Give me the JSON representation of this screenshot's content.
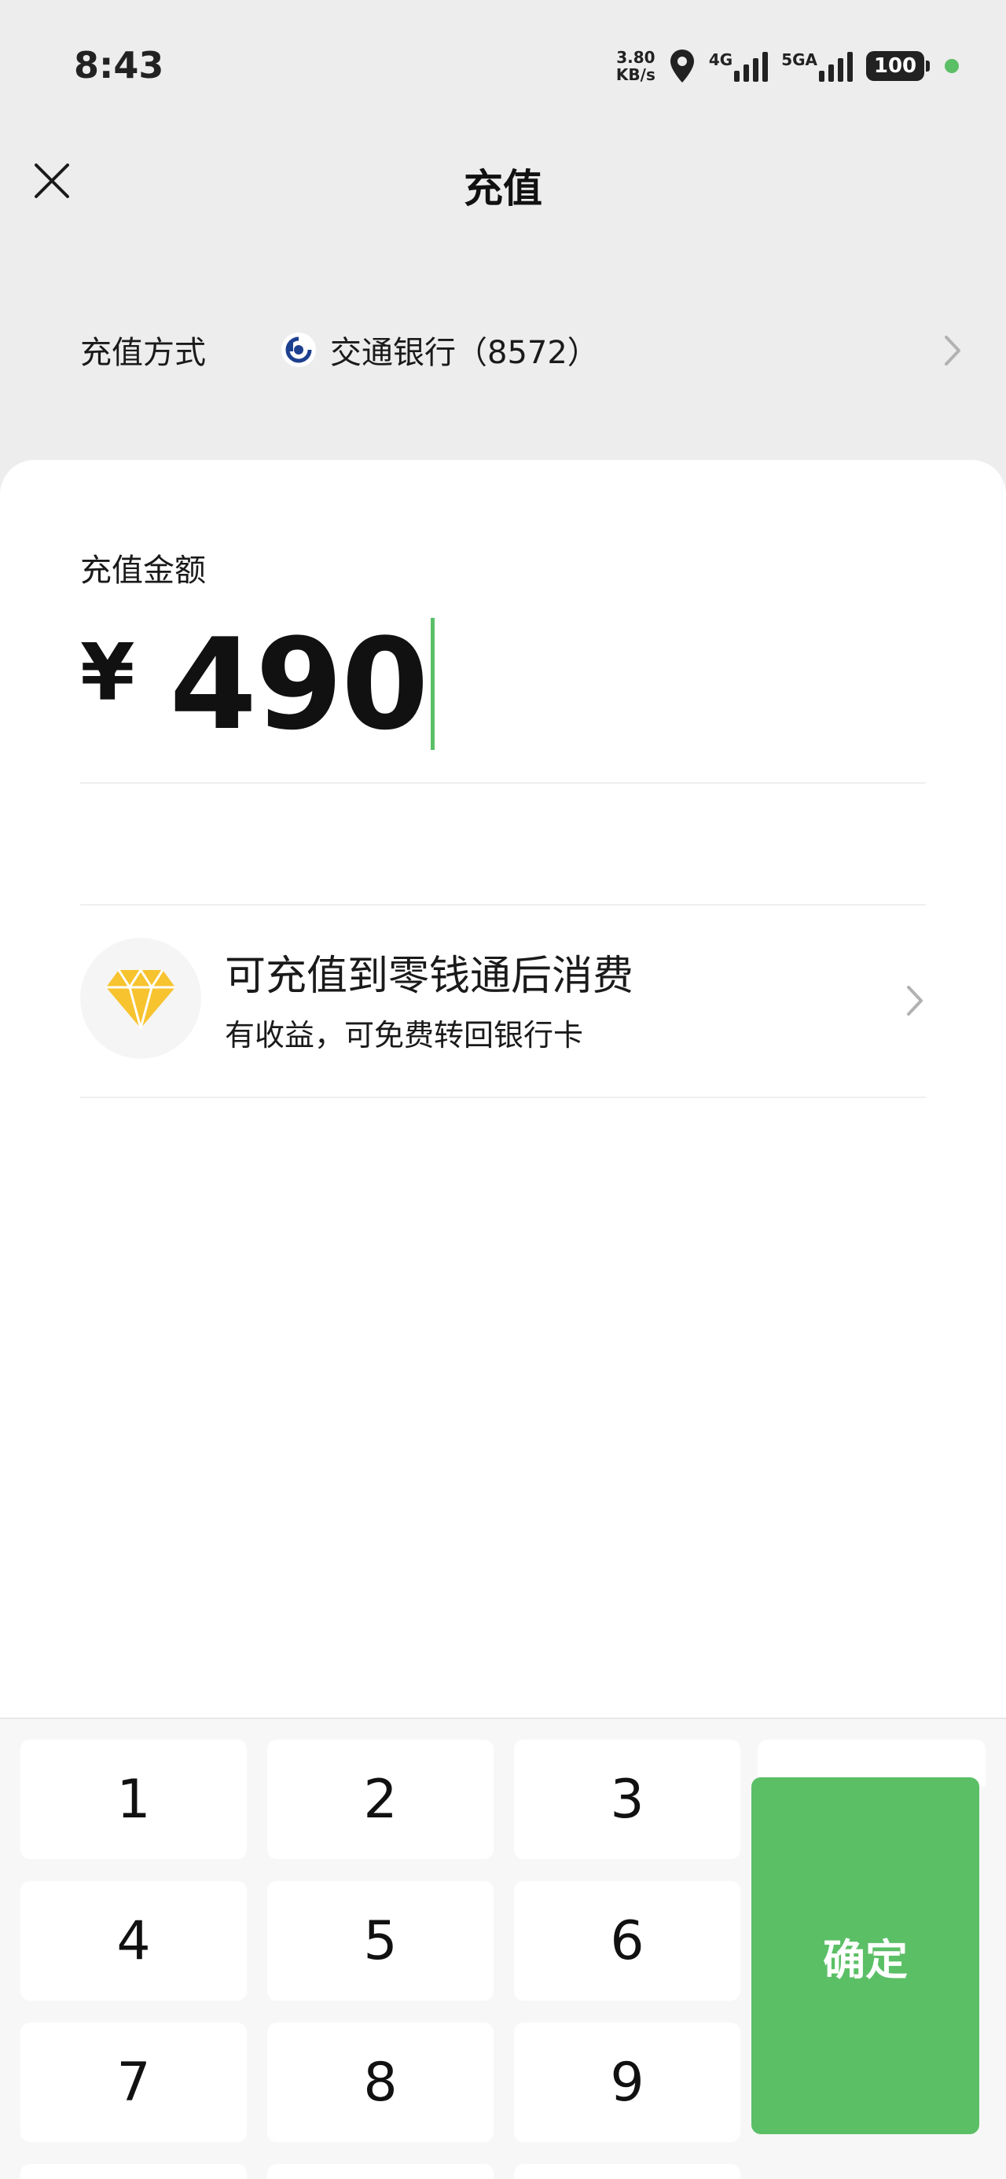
{
  "status_bar": {
    "time": "8:43",
    "net_speed_value": "3.80",
    "net_speed_unit": "KB/s",
    "net1": "4G",
    "net2": "5GA",
    "battery": "100"
  },
  "nav": {
    "title": "充值"
  },
  "payment_method": {
    "label": "充值方式",
    "bank": "交通银行（8572）"
  },
  "amount": {
    "label": "充值金额",
    "currency": "¥",
    "value": "490"
  },
  "promo": {
    "title": "可充值到零钱通后消费",
    "subtitle": "有收益，可免费转回银行卡"
  },
  "keypad": {
    "keys": [
      "1",
      "2",
      "3",
      "4",
      "5",
      "6",
      "7",
      "8",
      "9"
    ],
    "confirm": "确定"
  },
  "colors": {
    "accent": "#5bbf66",
    "promo_icon": "#f7c32e"
  }
}
